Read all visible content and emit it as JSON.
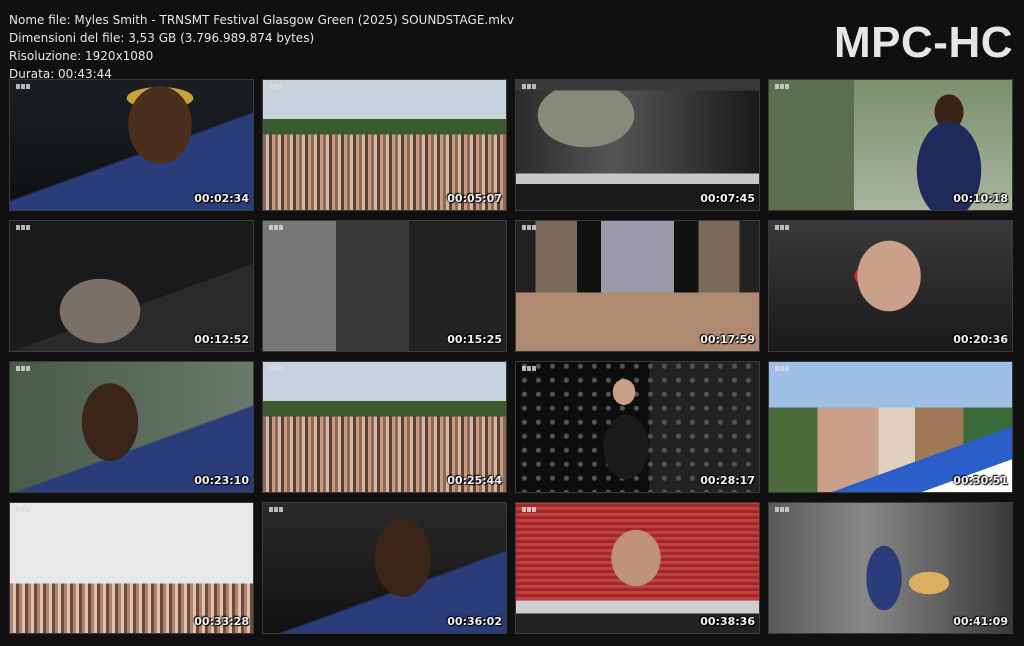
{
  "info": {
    "file_name": "Nome file: Myles Smith - TRNSMT Festival Glasgow Green (2025) SOUNDSTAGE.mkv",
    "file_size": "Dimensioni del file: 3,53 GB (3.796.989.874 bytes)",
    "resolution": "Risoluzione: 1920x1080",
    "duration": "Durata: 00:43:44"
  },
  "brand": "MPC-HC",
  "thumbnails": [
    {
      "timestamp": "00:02:34"
    },
    {
      "timestamp": "00:05:07"
    },
    {
      "timestamp": "00:07:45"
    },
    {
      "timestamp": "00:10:18"
    },
    {
      "timestamp": "00:12:52"
    },
    {
      "timestamp": "00:15:25"
    },
    {
      "timestamp": "00:17:59"
    },
    {
      "timestamp": "00:20:36"
    },
    {
      "timestamp": "00:23:10"
    },
    {
      "timestamp": "00:25:44"
    },
    {
      "timestamp": "00:28:17"
    },
    {
      "timestamp": "00:30:51"
    },
    {
      "timestamp": "00:33:28"
    },
    {
      "timestamp": "00:36:02"
    },
    {
      "timestamp": "00:38:36"
    },
    {
      "timestamp": "00:41:09"
    }
  ]
}
